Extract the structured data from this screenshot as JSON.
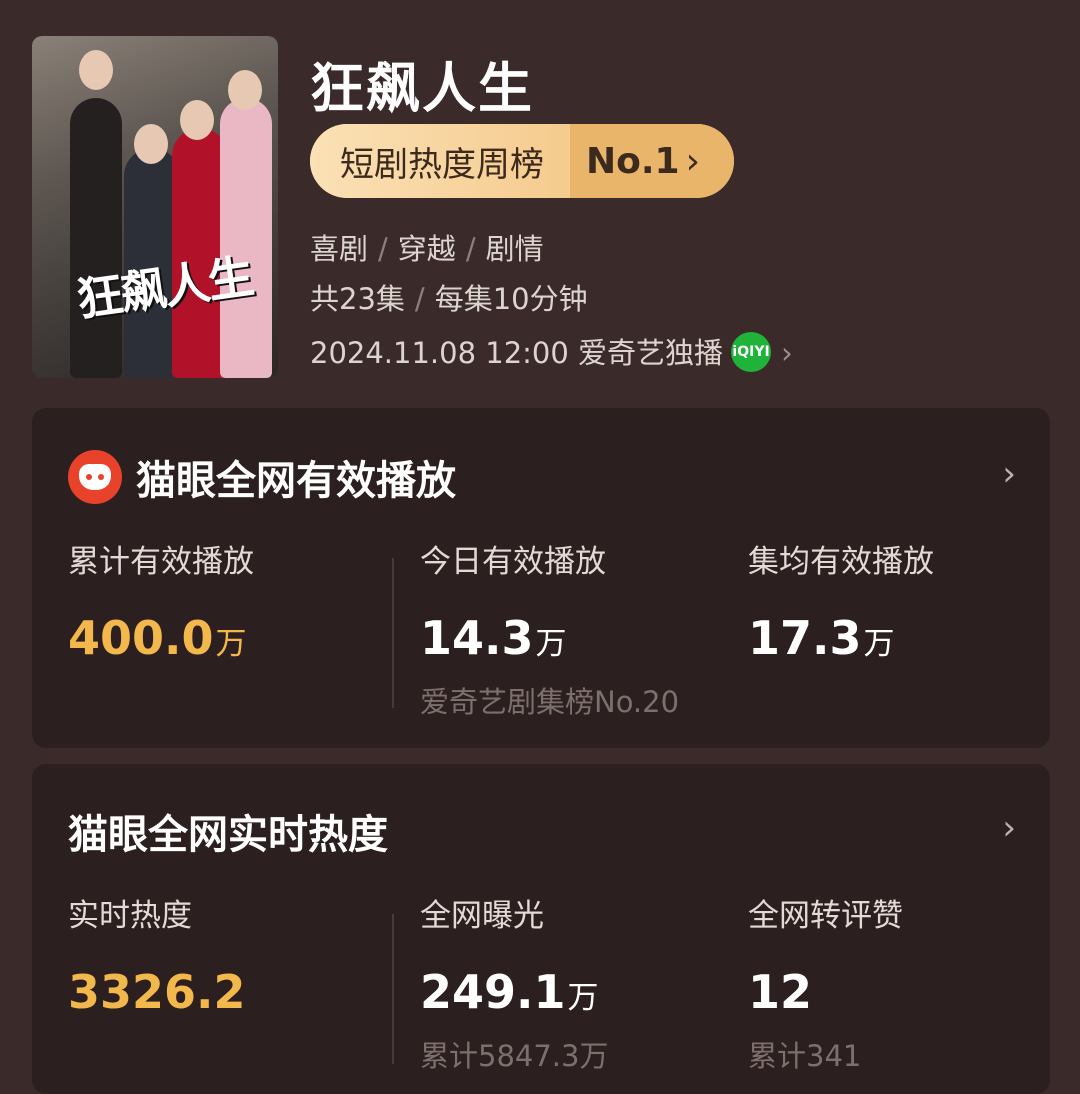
{
  "show": {
    "title": "狂飙人生",
    "poster_title": "狂飙人生",
    "rank_label": "短剧热度周榜",
    "rank_value": "No.1",
    "genres": [
      "喜剧",
      "穿越",
      "剧情"
    ],
    "episodes": "共23集",
    "episode_length": "每集10分钟",
    "release": "2024.11.08 12:00 爱奇艺独播",
    "platform_icon": "iqiyi-logo"
  },
  "card1": {
    "title": "猫眼全网有效播放",
    "icon": "maoyan-cat-icon",
    "stats": [
      {
        "label": "累计有效播放",
        "value": "400.0",
        "unit": "万",
        "sub": ""
      },
      {
        "label": "今日有效播放",
        "value": "14.3",
        "unit": "万",
        "sub": "爱奇艺剧集榜No.20"
      },
      {
        "label": "集均有效播放",
        "value": "17.3",
        "unit": "万",
        "sub": ""
      }
    ]
  },
  "card2": {
    "title": "猫眼全网实时热度",
    "stats": [
      {
        "label": "实时热度",
        "value": "3326.2",
        "unit": "",
        "sub": ""
      },
      {
        "label": "全网曝光",
        "value": "249.1",
        "unit": "万",
        "sub": "累计5847.3万"
      },
      {
        "label": "全网转评赞",
        "value": "12",
        "unit": "",
        "sub": "累计341"
      }
    ]
  },
  "colors": {
    "background": "#3a2a29",
    "card": "#2c1f1f",
    "highlight": "#f2b84b",
    "rank_badge": "#f4c98f",
    "iqiyi_green": "#1fb33a"
  }
}
